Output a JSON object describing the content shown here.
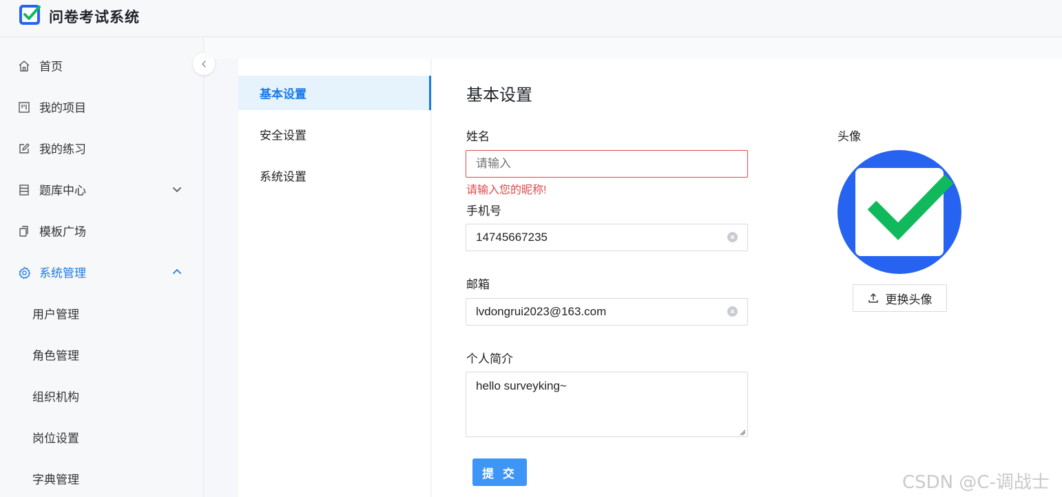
{
  "app": {
    "title": "问卷考试系统"
  },
  "sidebar": {
    "items": [
      {
        "label": "首页",
        "icon": "home-icon"
      },
      {
        "label": "我的项目",
        "icon": "project-board-icon"
      },
      {
        "label": "我的练习",
        "icon": "edit-icon"
      },
      {
        "label": "题库中心",
        "icon": "question-bank-icon",
        "expandable": true,
        "expanded": false
      },
      {
        "label": "模板广场",
        "icon": "template-copy-icon"
      },
      {
        "label": "系统管理",
        "icon": "gear-icon",
        "expandable": true,
        "expanded": true,
        "active": true
      }
    ],
    "sub_items": [
      {
        "label": "用户管理"
      },
      {
        "label": "角色管理"
      },
      {
        "label": "组织机构"
      },
      {
        "label": "岗位设置"
      },
      {
        "label": "字典管理"
      }
    ]
  },
  "settings_nav": {
    "items": [
      {
        "label": "基本设置",
        "active": true
      },
      {
        "label": "安全设置",
        "active": false
      },
      {
        "label": "系统设置",
        "active": false
      }
    ]
  },
  "form": {
    "title": "基本设置",
    "name": {
      "label": "姓名",
      "value": "",
      "placeholder": "请输入",
      "error": "请输入您的昵称!"
    },
    "phone": {
      "label": "手机号",
      "value": "14745667235"
    },
    "email": {
      "label": "邮箱",
      "value": "lvdongrui2023@163.com"
    },
    "bio": {
      "label": "个人简介",
      "value": "hello surveyking~"
    },
    "submit_label": "提 交"
  },
  "avatar": {
    "label": "头像",
    "change_label": "更换头像"
  },
  "colors": {
    "primary": "#1a7ae8",
    "button": "#3d95f5",
    "error": "#e0474c",
    "avatar_bg": "#2563f0",
    "check_green": "#10b95b"
  },
  "watermark": "CSDN @C-调战士"
}
